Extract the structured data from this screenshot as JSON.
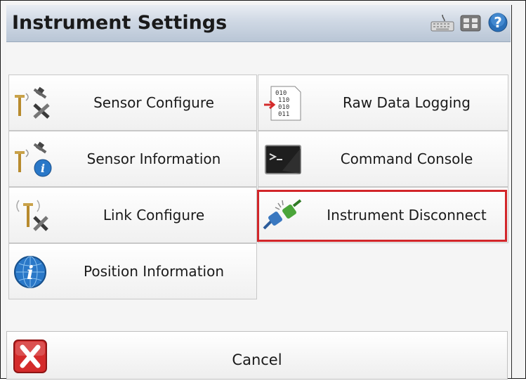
{
  "window": {
    "title": "Instrument Settings"
  },
  "toolbar": {
    "icons": [
      "keyboard-icon",
      "calculator-icon",
      "help-icon"
    ]
  },
  "buttons": {
    "sensor_configure": "Sensor Configure",
    "raw_data_logging": "Raw Data Logging",
    "sensor_information": "Sensor Information",
    "command_console": "Command Console",
    "link_configure": "Link Configure",
    "instrument_disconnect": "Instrument Disconnect",
    "position_information": "Position Information"
  },
  "binary_icon": {
    "line1": "010",
    "line2": "110",
    "line3": "010",
    "line4": "011"
  },
  "cancel": {
    "label": "Cancel"
  },
  "colors": {
    "highlight": "#d2262a",
    "titlebar": "#cfd8e4",
    "cancel_red": "#d42b2b"
  }
}
